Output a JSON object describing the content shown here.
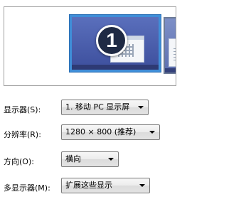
{
  "preview": {
    "primary_monitor_number": "1"
  },
  "settings": {
    "display": {
      "label": "显示器(S):",
      "value": "1. 移动 PC 显示屏"
    },
    "resolution": {
      "label": "分辨率(R):",
      "value": "1280 × 800 (推荐)"
    },
    "orientation": {
      "label": "方向(O):",
      "value": "横向"
    },
    "multiple_displays": {
      "label": "多显示器(M):",
      "value": "扩展这些显示"
    }
  },
  "icons": {
    "dropdown": "chevron-down-icon"
  }
}
